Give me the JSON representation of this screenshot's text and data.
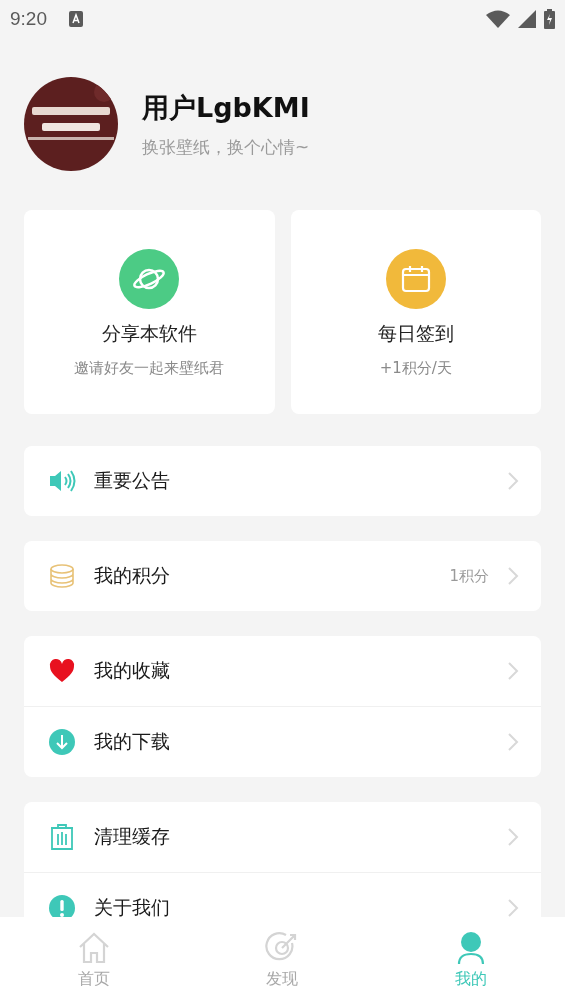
{
  "status_bar": {
    "time": "9:20"
  },
  "profile": {
    "name": "用户LgbKMI",
    "motto": "换张壁纸，换个心情~"
  },
  "feature_cards": [
    {
      "title": "分享本软件",
      "subtitle": "邀请好友一起来壁纸君"
    },
    {
      "title": "每日签到",
      "subtitle": "+1积分/天"
    }
  ],
  "menu_groups": [
    [
      {
        "label": "重要公告"
      }
    ],
    [
      {
        "label": "我的积分",
        "value": "1积分"
      }
    ],
    [
      {
        "label": "我的收藏"
      },
      {
        "label": "我的下载"
      }
    ],
    [
      {
        "label": "清理缓存"
      },
      {
        "label": "关于我们"
      }
    ]
  ],
  "bottom_nav": [
    {
      "label": "首页",
      "selected": false
    },
    {
      "label": "发现",
      "selected": false
    },
    {
      "label": "我的",
      "selected": true
    }
  ]
}
